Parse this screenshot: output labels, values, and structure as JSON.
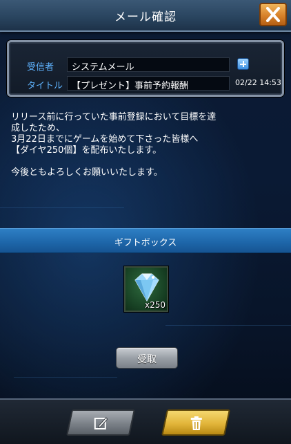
{
  "header": {
    "title": "メール確認",
    "close_icon": "close-x-icon",
    "close_color": "#e08a2c"
  },
  "mail": {
    "recipient_label": "受信者",
    "recipient_value": "システムメール",
    "title_label": "タイトル",
    "title_value": "【プレゼント】事前予約報酬",
    "date": "02/22 14:53",
    "add_icon": "plus-icon"
  },
  "message": {
    "lines": [
      "リリース前に行っていた事前登録において目標を達",
      "成したため、",
      "3月22日までにゲームを始めて下さった皆様へ",
      "【ダイヤ250個】を配布いたします。",
      "",
      "今後ともよろしくお願いいたします。"
    ]
  },
  "gift": {
    "header": "ギフトボックス",
    "item_icon": "diamond-icon",
    "quantity": "x250",
    "receive_label": "受取"
  },
  "footer": {
    "edit_icon": "edit-pencil-icon",
    "delete_icon": "trash-icon"
  },
  "colors": {
    "accent_blue": "#5fb4ff",
    "gift_bar": "#1d65a8",
    "delete_button": "#e2b53a"
  }
}
